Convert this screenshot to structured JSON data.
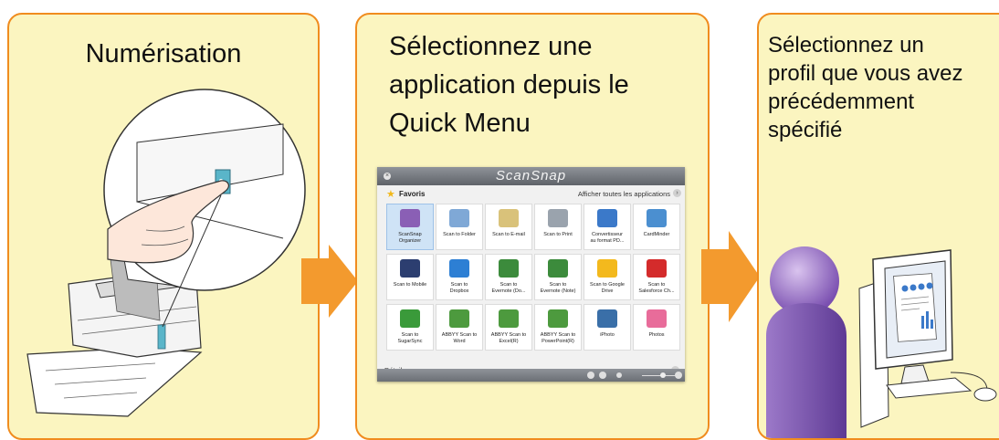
{
  "panels": [
    {
      "title": "Numérisation"
    },
    {
      "title_lines": [
        "Sélectionnez une",
        "application depuis le",
        "Quick Menu"
      ]
    },
    {
      "title_lines": [
        "Sélectionnez un",
        "profil que vous avez",
        "précédemment",
        "spécifié"
      ]
    }
  ],
  "quick_menu": {
    "brand": "ScanSnap",
    "close_glyph": "×",
    "favorites_label": "Favoris",
    "show_all_label": "Afficher toutes les applications",
    "details_label": "Détails",
    "chevron_glyph": "›",
    "expand_glyph": "⌄",
    "tiles": [
      {
        "label": "ScanSnap\nOrganizer",
        "icon": "folder-organizer-icon",
        "color": "#8a5fb5",
        "selected": true
      },
      {
        "label": "Scan to Folder",
        "icon": "folder-icon",
        "color": "#7fa8d6"
      },
      {
        "label": "Scan to E-mail",
        "icon": "envelope-icon",
        "color": "#d9c27a"
      },
      {
        "label": "Scan to Print",
        "icon": "printer-icon",
        "color": "#9aa3ad"
      },
      {
        "label": "Convertisseur\nau format PD...",
        "icon": "sa-convert-icon",
        "color": "#3b79c9"
      },
      {
        "label": "CardMinder",
        "icon": "card-icon",
        "color": "#4b8fd0"
      },
      {
        "label": "Scan to Mobile",
        "icon": "mobile-icon",
        "color": "#2c3e70"
      },
      {
        "label": "Scan to\nDropbox",
        "icon": "dropbox-icon",
        "color": "#2d7fd4"
      },
      {
        "label": "Scan to\nEvernote (Do...",
        "icon": "evernote-doc-icon",
        "color": "#3c8b3c"
      },
      {
        "label": "Scan to\nEvernote (Note)",
        "icon": "evernote-note-icon",
        "color": "#3c8b3c"
      },
      {
        "label": "Scan to Google\nDrive",
        "icon": "google-drive-icon",
        "color": "#f3b91d"
      },
      {
        "label": "Scan to\nSalesforce Ch...",
        "icon": "salesforce-icon",
        "color": "#d42b2b"
      },
      {
        "label": "Scan to\nSugarSync",
        "icon": "sugarsync-icon",
        "color": "#3a9a3a"
      },
      {
        "label": "ABBYY Scan to\nWord",
        "icon": "abbyy-word-icon",
        "color": "#4d9a3e"
      },
      {
        "label": "ABBYY Scan to\nExcel(R)",
        "icon": "abbyy-excel-icon",
        "color": "#4d9a3e"
      },
      {
        "label": "ABBYY Scan to\nPowerPoint(R)",
        "icon": "abbyy-powerpoint-icon",
        "color": "#4d9a3e"
      },
      {
        "label": "iPhoto",
        "icon": "iphoto-icon",
        "color": "#3a6fa8"
      },
      {
        "label": "Photos",
        "icon": "photos-icon",
        "color": "#e86c9a"
      }
    ]
  },
  "colors": {
    "panel_bg": "#fbf5c0",
    "panel_border": "#f08c1f",
    "arrow": "#f39a2e"
  }
}
